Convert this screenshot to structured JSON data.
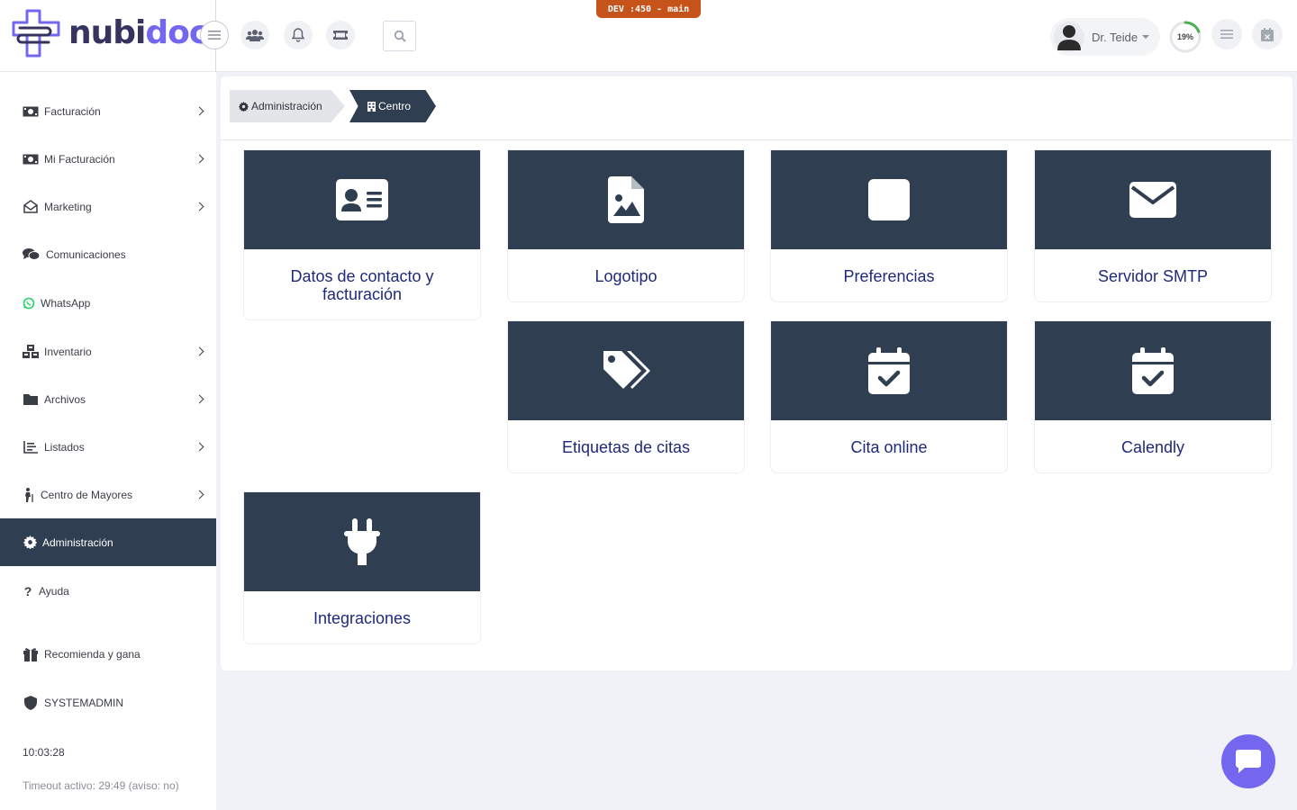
{
  "app": {
    "logo_nubi": "nubi",
    "logo_doc": "doc",
    "brand_color": "#7367f0",
    "dark_color": "#2f3e50",
    "dev_badge": "DEV :450 - main"
  },
  "header": {
    "icons": [
      "menu-icon",
      "users-icon",
      "bell-icon",
      "ticket-icon",
      "search-icon"
    ],
    "user_name": "Dr. Teide",
    "progress_label": "19%",
    "progress_value": 0.19,
    "right_icons": [
      "list-icon",
      "calendar-x-icon"
    ]
  },
  "sidebar": {
    "items": [
      {
        "label": "Facturación",
        "icon": "money-bill-icon",
        "has_children": true
      },
      {
        "label": "Mi Facturación",
        "icon": "money-bill-icon",
        "has_children": true
      },
      {
        "label": "Marketing",
        "icon": "envelope-open-icon",
        "has_children": true
      },
      {
        "label": "Comunicaciones",
        "icon": "comments-icon",
        "has_children": false
      },
      {
        "label": "WhatsApp",
        "icon": "whatsapp-icon",
        "has_children": false
      },
      {
        "label": "Inventario",
        "icon": "cubes-icon",
        "has_children": true
      },
      {
        "label": "Archivos",
        "icon": "folder-icon",
        "has_children": true
      },
      {
        "label": "Listados",
        "icon": "list-icon",
        "has_children": true
      },
      {
        "label": "Centro de Mayores",
        "icon": "elderly-icon",
        "has_children": true
      },
      {
        "label": "Administración",
        "icon": "gear-icon",
        "has_children": false,
        "active": true
      },
      {
        "label": "Ayuda",
        "icon": "question-icon",
        "has_children": false
      },
      {
        "label": "Recomienda y gana",
        "icon": "gift-icon",
        "has_children": false
      },
      {
        "label": "SYSTEMADMIN",
        "icon": "shield-icon",
        "has_children": false
      }
    ],
    "clock": "10:03:28",
    "timeout": "Timeout activo: 29:49 (aviso: no)"
  },
  "breadcrumb": {
    "parent": "Administración",
    "current": "Centro"
  },
  "cards": [
    {
      "label": "Datos de contacto y facturación",
      "icon": "id-card-icon"
    },
    {
      "label": "Logotipo",
      "icon": "file-image-icon"
    },
    {
      "label": "Preferencias",
      "icon": "square-icon"
    },
    {
      "label": "Servidor SMTP",
      "icon": "envelope-icon"
    },
    {
      "label": "Etiquetas de citas",
      "icon": "tags-icon"
    },
    {
      "label": "Cita online",
      "icon": "calendar-check-icon"
    },
    {
      "label": "Calendly",
      "icon": "calendar-check-icon"
    },
    {
      "label": "Integraciones",
      "icon": "plug-icon"
    }
  ],
  "chat": {
    "icon": "chat-bubble-icon"
  }
}
